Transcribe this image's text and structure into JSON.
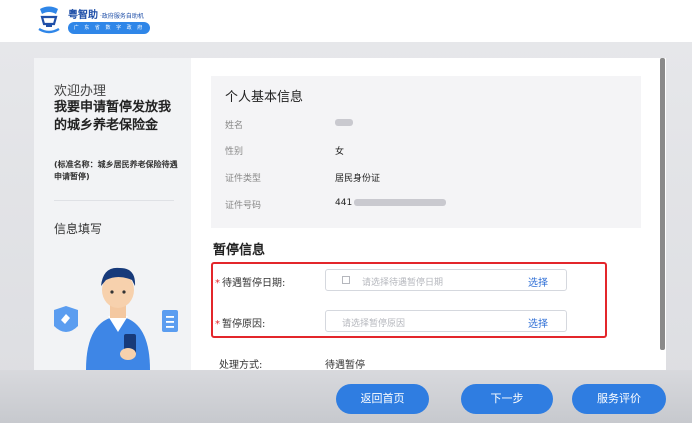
{
  "header": {
    "brand_name": "粤智助",
    "brand_sub": "·政府服务自助机",
    "brand_pill": "广 东 省 数 字 政 府"
  },
  "sidebar": {
    "welcome": "欢迎办理",
    "title": "我要申请暂停发放我的城乡养老保险金",
    "standard_name": "(标准名称：城乡居民养老保险待遇申请暂停)",
    "step": "信息填写"
  },
  "basic_info": {
    "title": "个人基本信息",
    "rows": [
      {
        "label": "姓名",
        "value": ""
      },
      {
        "label": "性别",
        "value": "女"
      },
      {
        "label": "证件类型",
        "value": "居民身份证"
      },
      {
        "label": "证件号码",
        "value": "441"
      }
    ]
  },
  "pause_info": {
    "title": "暂停信息",
    "required_mark": "*",
    "date_label": "待遇暂停日期:",
    "date_placeholder": "请选择待遇暂停日期",
    "date_select": "选择",
    "reason_label": "暂停原因:",
    "reason_placeholder": "请选择暂停原因",
    "reason_select": "选择",
    "processing_label": "处理方式:",
    "processing_value": "待遇暂停"
  },
  "footer": {
    "home_button": "返回首页",
    "next_button": "下一步",
    "rate_button": "服务评价"
  },
  "colors": {
    "accent": "#2f7de1",
    "highlight_border": "#e3262b",
    "link": "#2f6fd6"
  }
}
